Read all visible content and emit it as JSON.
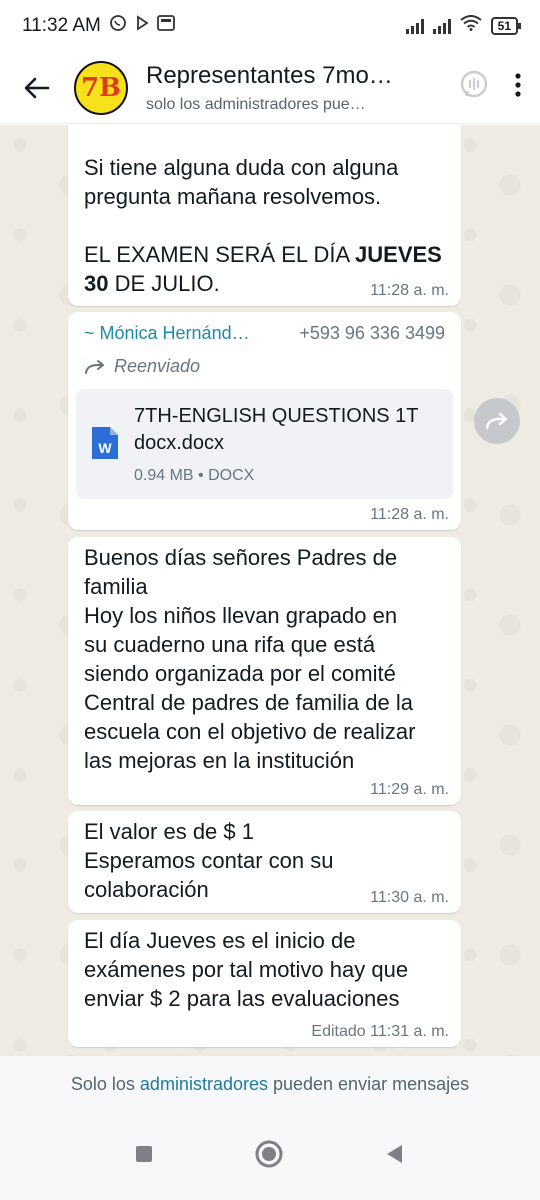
{
  "status_bar": {
    "time": "11:32 AM",
    "battery": "51"
  },
  "header": {
    "avatar_text": "7B",
    "title": "Representantes 7mo…",
    "subtitle": "solo los administradores pue…"
  },
  "messages": [
    {
      "lines": [
        "Si tiene alguna duda con alguna",
        "pregunta mañana resolvemos.",
        "",
        "EL EXAMEN SERÁ EL DÍA "
      ],
      "text_part1": "Si tiene alguna duda con alguna pregunta mañana resolvemos.",
      "text_part2_prefix": "EL EXAMEN SERÁ EL DÍA ",
      "text_bold1": "JUEVES",
      "text_bold2": "30",
      "text_part2_suffix": " DE JULIO.",
      "time": "11:28 a. m."
    },
    {
      "sender_name": "~ Mónica Hernánd…",
      "sender_phone": "+593 96 336 3499",
      "forwarded_label": "Reenviado",
      "doc_name": "7TH-ENGLISH QUESTIONS 1T docx.docx",
      "doc_size": "0.94 MB",
      "doc_sep": "•",
      "doc_type": "DOCX",
      "time": "11:28 a. m."
    },
    {
      "text": "Buenos días señores Padres de familia\nHoy los niños llevan grapado en su cuaderno una rifa que está siendo organizada por el comité Central de padres de familia de la escuela con el objetivo de realizar las mejoras en la institución",
      "time": "11:29 a. m."
    },
    {
      "text": "El valor es de $ 1\nEsperamos contar con su colaboración",
      "time": "11:30 a. m."
    },
    {
      "text": "El día  Jueves es el inicio de exámenes por tal motivo hay que enviar $ 2 para las evaluaciones",
      "edited_label": "Editado",
      "time": "11:31 a. m."
    }
  ],
  "footer": {
    "prefix": "Solo los ",
    "highlight": "administradores",
    "suffix": " pueden enviar mensajes"
  },
  "colors": {
    "chat_bg": "#efeae2",
    "accent_link": "#1f8aa8",
    "avatar_bg": "#f7e11b"
  }
}
